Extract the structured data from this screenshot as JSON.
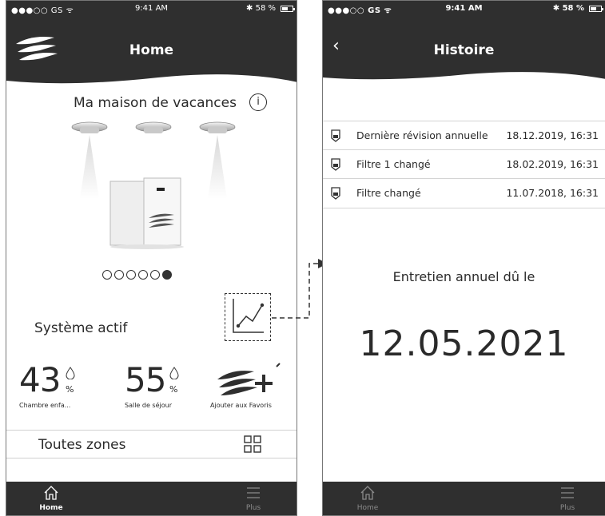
{
  "left_screen": {
    "status_bar": {
      "carrier": "●●●○○ GS ᯤ",
      "time": "9:41 AM",
      "battery": "✱ 58 %"
    },
    "header": {
      "title": "Home"
    },
    "house_name": "Ma maison de vacances",
    "info_symbol": "i",
    "carousel": {
      "count": 6,
      "active_index": 5
    },
    "system_status": "Système actif",
    "metrics": [
      {
        "value": "43",
        "unit": "%",
        "label": "Chambre enfa..."
      },
      {
        "value": "55",
        "unit": "%",
        "label": "Salle de séjour"
      }
    ],
    "favorites_label": "Ajouter aux Favoris",
    "zones_label": "Toutes zones",
    "tabbar": {
      "home_label": "Home",
      "more_label": "Plus"
    }
  },
  "right_screen": {
    "status_bar": {
      "carrier": "●●●○○ GS ᯤ",
      "time": "9:41 AM",
      "battery": "✱ 58 %"
    },
    "header": {
      "title": "Histoire"
    },
    "history": [
      {
        "text": "Dernière révision annuelle",
        "date": "18.12.2019, 16:31"
      },
      {
        "text": "Filtre 1 changé",
        "date": "18.02.2019, 16:31"
      },
      {
        "text": "Filtre changé",
        "date": "11.07.2018, 16:31"
      }
    ],
    "due_label": "Entretien annuel dû le",
    "due_date": "12.05.2021",
    "tabbar": {
      "home_label": "Home",
      "more_label": "Plus"
    }
  },
  "colors": {
    "header_bg": "#2f2f2f",
    "tabbar_bg": "#2f2f2f",
    "text": "#2a2a2a"
  },
  "icons": [
    "logo-waves-icon",
    "info-icon",
    "ceiling-sensor-icon",
    "device-unit-icon",
    "graph-icon",
    "droplet-icon",
    "add-favorite-icon",
    "grid-icon",
    "home-icon",
    "menu-icon",
    "back-chevron-icon",
    "filter-cartridge-icon"
  ]
}
